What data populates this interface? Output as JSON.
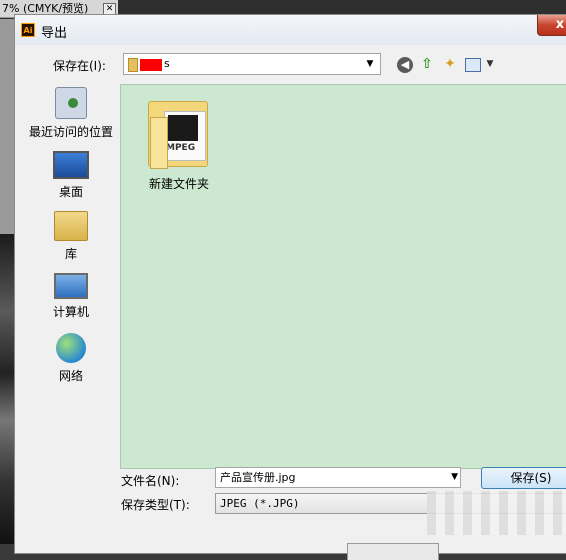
{
  "background_tab": {
    "label": "7% (CMYK/预览)",
    "close": "✕"
  },
  "dialog": {
    "title": "导出",
    "app_icon_text": "Ai",
    "close_glyph": "x"
  },
  "save_in": {
    "label": "保存在(I):",
    "value": "s",
    "arrow": "▼"
  },
  "toolbar": {
    "view_arrow": "▼"
  },
  "places": [
    {
      "label": "最近访问的位置",
      "icon": "recent-places-icon"
    },
    {
      "label": "桌面",
      "icon": "desktop-icon"
    },
    {
      "label": "库",
      "icon": "library-icon"
    },
    {
      "label": "计算机",
      "icon": "computer-icon"
    },
    {
      "label": "网络",
      "icon": "network-icon"
    }
  ],
  "files": [
    {
      "name": "新建文件夹",
      "overlay_text": "MPEG"
    }
  ],
  "filename": {
    "label": "文件名(N):",
    "value": "产品宣传册.jpg",
    "arrow": "▼"
  },
  "filetype": {
    "label": "保存类型(T):",
    "value": "JPEG (*.JPG)"
  },
  "buttons": {
    "save": "保存(S)"
  },
  "colors": {
    "list_bg": "#cce8d0",
    "close_red": "#c8452e",
    "redaction": "#ff0000"
  }
}
